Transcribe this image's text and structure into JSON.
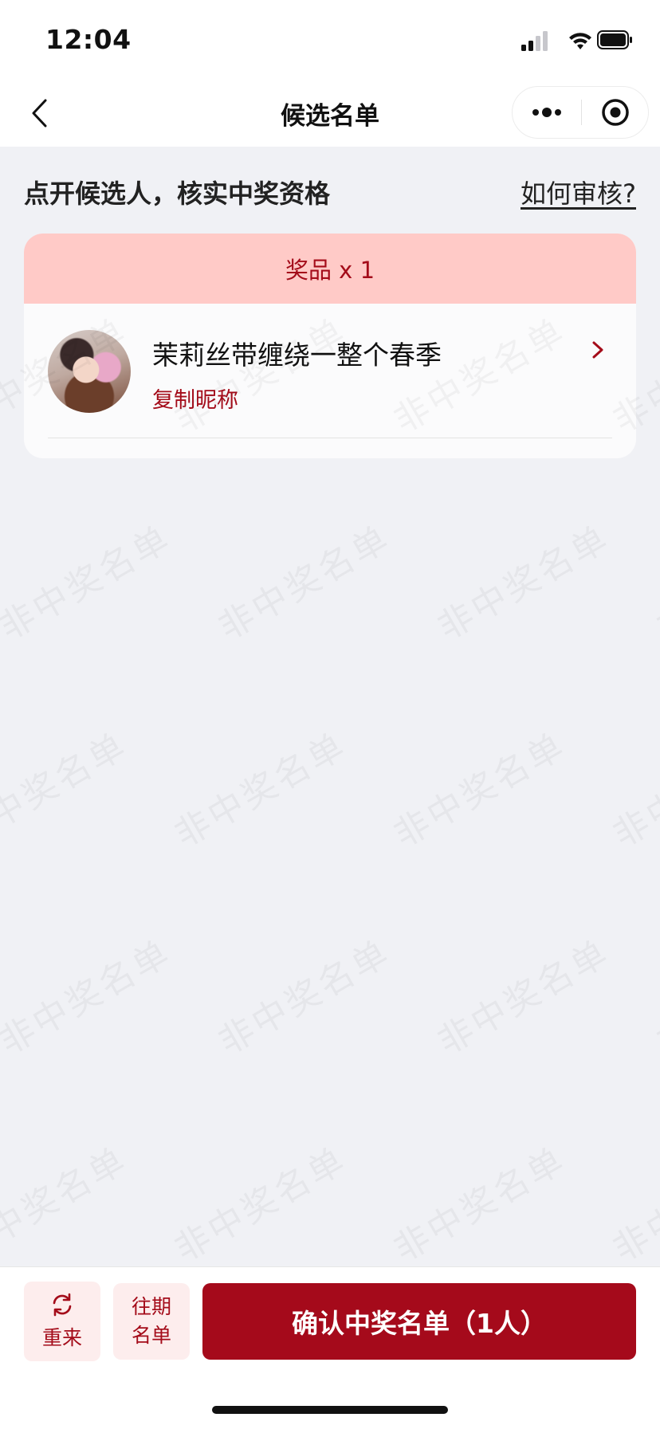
{
  "status_bar": {
    "time": "12:04"
  },
  "nav": {
    "title": "候选名单",
    "back_icon": "chevron-left-icon",
    "more_icon": "more-dots-icon",
    "close_icon": "target-circle-icon"
  },
  "header": {
    "hint": "点开候选人，核实中奖资格",
    "how_to_link": "如何审核?"
  },
  "prize_card": {
    "title": "奖品 x 1",
    "candidates": [
      {
        "name": "茉莉丝带缠绕一整个春季",
        "copy_label": "复制昵称"
      }
    ]
  },
  "watermark": {
    "text": "非中奖名单"
  },
  "bottom_bar": {
    "reset_label": "重来",
    "reset_icon": "refresh-icon",
    "history_line1": "往期",
    "history_line2": "名单",
    "confirm_label": "确认中奖名单（1人）"
  },
  "colors": {
    "accent": "#a50a1b",
    "card_header_bg": "#ffcac7",
    "page_bg": "#f0f1f5"
  }
}
